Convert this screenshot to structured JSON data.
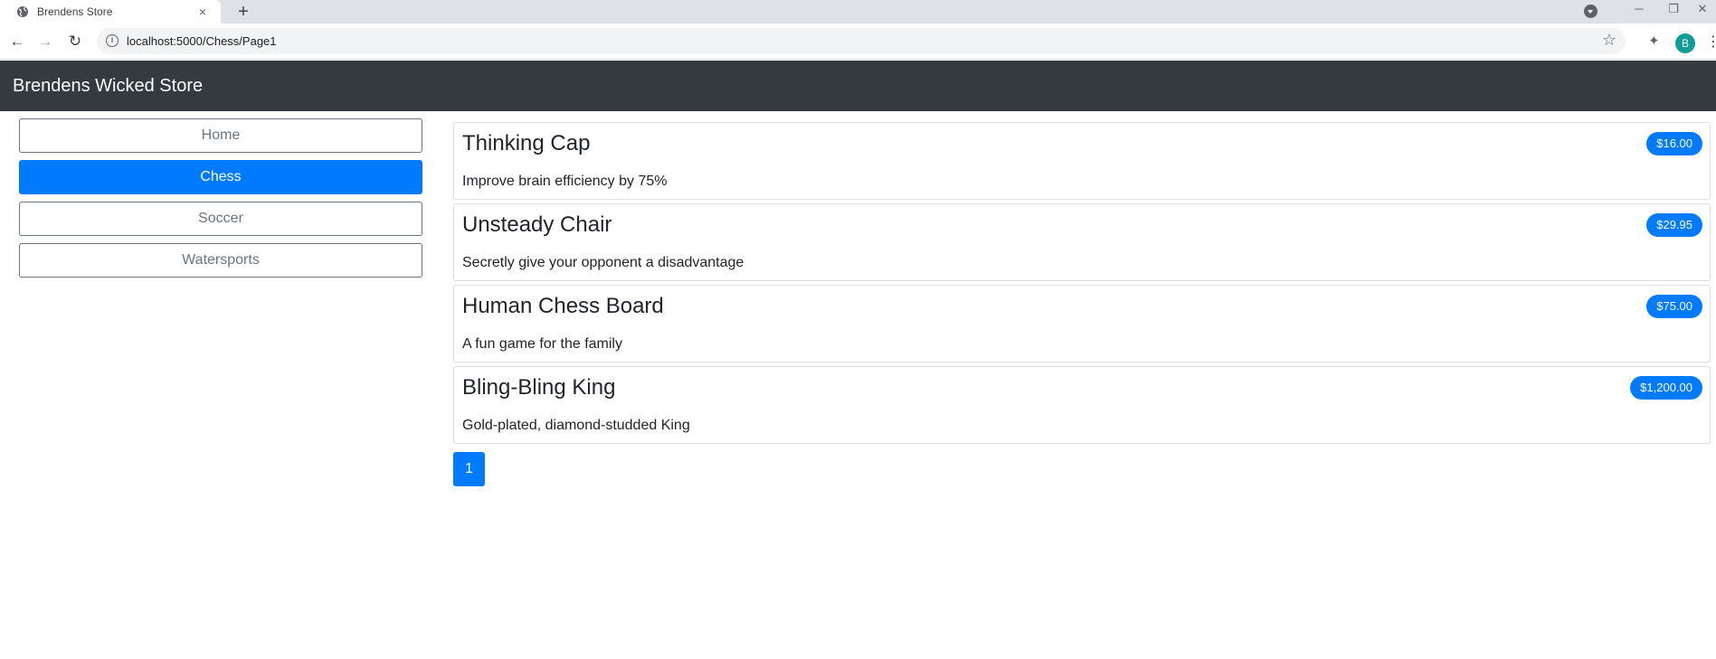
{
  "browser": {
    "tab_title": "Brendens Store",
    "tab_close": "×",
    "new_tab": "+",
    "url": "localhost:5000/Chess/Page1",
    "profile_initial": "B",
    "win_minimize": "─",
    "win_restore": "❐",
    "win_close": "✕"
  },
  "store": {
    "brand": "Brendens Wicked Store",
    "categories": [
      {
        "label": "Home",
        "active": false
      },
      {
        "label": "Chess",
        "active": true
      },
      {
        "label": "Soccer",
        "active": false
      },
      {
        "label": "Watersports",
        "active": false
      }
    ],
    "products": [
      {
        "name": "Thinking Cap",
        "description": "Improve brain efficiency by 75%",
        "price": "$16.00"
      },
      {
        "name": "Unsteady Chair",
        "description": "Secretly give your opponent a disadvantage",
        "price": "$29.95"
      },
      {
        "name": "Human Chess Board",
        "description": "A fun game for the family",
        "price": "$75.00"
      },
      {
        "name": "Bling-Bling King",
        "description": "Gold-plated, diamond-studded King",
        "price": "$1,200.00"
      }
    ],
    "pagination": {
      "current_page": "1"
    }
  },
  "colors": {
    "navbar": "#343a40",
    "primary": "#007bff",
    "secondary": "#6c757d"
  },
  "icons": [
    "globe-icon",
    "back-icon",
    "forward-icon",
    "reload-icon",
    "info-icon",
    "star-icon",
    "extensions-icon",
    "menu-icon",
    "tab-search-icon"
  ]
}
